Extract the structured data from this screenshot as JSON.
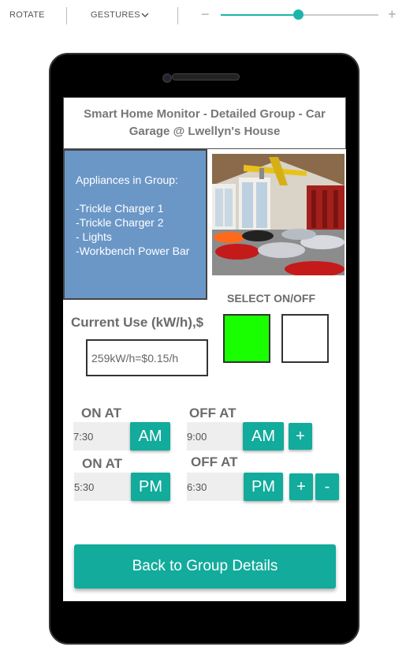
{
  "toolbar": {
    "rotate_label": "ROTATE",
    "gestures_label": "GESTURES",
    "zoom_minus": "−",
    "zoom_plus": "+",
    "zoom_level": 0.49
  },
  "screen": {
    "title": "Smart Home Monitor - Detailed Group - Car Garage @ Lwellyn's House",
    "appliances_text": "Appliances in Group:\n\n-Trickle Charger 1\n-Trickle Charger 2\n- Lights\n-Workbench Power Bar",
    "select_label": "SELECT ON/OFF",
    "switch_on_color": "#19ff00",
    "switch_off_color": "#ffffff",
    "current_use_label": "Current Use (kW/h),$",
    "current_use_value": "259kW/h=$0.15/h",
    "schedules": [
      {
        "on_label": "ON AT",
        "on_time": "7:30",
        "on_period": "AM",
        "off_label": "OFF AT",
        "off_time": "9:00",
        "off_period": "AM",
        "plus": "+"
      },
      {
        "on_label": "ON AT",
        "on_time": "5:30",
        "on_period": "PM",
        "off_label": "OFF AT",
        "off_time": "6:30",
        "off_period": "PM",
        "plus": "+",
        "minus": "-"
      }
    ],
    "back_button": "Back to Group Details"
  },
  "colors": {
    "accent": "#12ab9c",
    "panel": "#6b97c7"
  }
}
